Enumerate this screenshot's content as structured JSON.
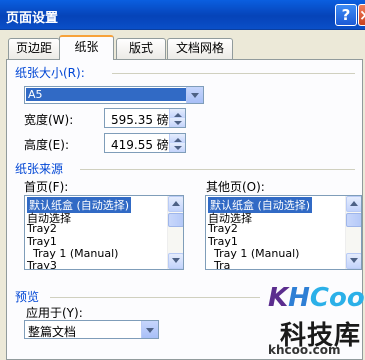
{
  "window": {
    "title": "页面设置",
    "help_label": "?",
    "close_label": "×"
  },
  "tabs": [
    {
      "label": "页边距",
      "active": false
    },
    {
      "label": "纸张",
      "active": true
    },
    {
      "label": "版式",
      "active": false
    },
    {
      "label": "文档网格",
      "active": false
    }
  ],
  "paper_size": {
    "group_label": "纸张大小(R):",
    "selected": "A5",
    "width_label": "宽度(W):",
    "width_value": "595.35 磅",
    "height_label": "高度(E):",
    "height_value": "419.55 磅"
  },
  "paper_source": {
    "group_label": "纸张来源",
    "first_page": {
      "label": "首页(F):",
      "items": [
        "默认纸盒 (自动选择)",
        "自动选择",
        "Tray2",
        "Tray1",
        "Tray 1 (Manual)",
        "Tray3"
      ],
      "selected_index": 0
    },
    "other_pages": {
      "label": "其他页(O):",
      "items": [
        "默认纸盒 (自动选择)",
        "自动选择",
        "Tray2",
        "Tray1",
        "Tray 1 (Manual)",
        "Tra"
      ],
      "selected_index": 0
    }
  },
  "preview": {
    "group_label": "预览",
    "apply_label": "应用于(Y):",
    "apply_value": "整篇文档"
  },
  "watermark": {
    "logo_k": "K",
    "logo_h": "H",
    "logo_c": "Coo",
    "name": "科技库",
    "url": "khcoo.com"
  },
  "colors": {
    "accent": "#0046d5",
    "selection": "#316ac5",
    "tab_highlight": "#f7a23b",
    "titlebar": "#0a5fe0"
  }
}
